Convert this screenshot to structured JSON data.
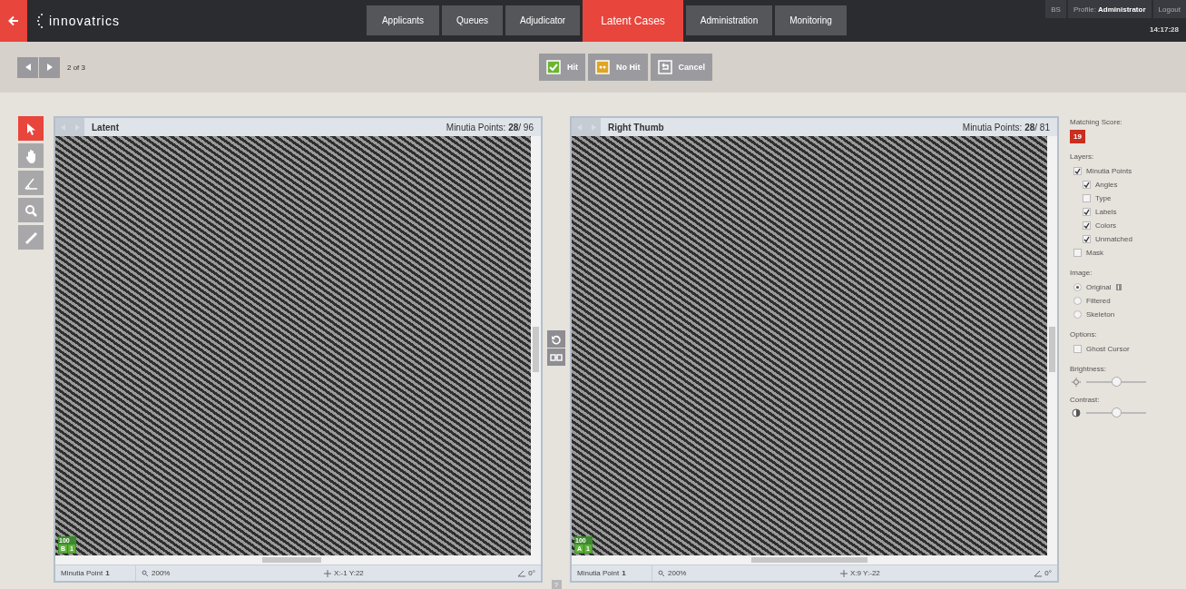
{
  "app": {
    "logo": "innovatrics"
  },
  "nav_tabs": [
    {
      "label": "Applicants",
      "selected": false
    },
    {
      "label": "Queues",
      "selected": false
    },
    {
      "label": "Adjudicator",
      "selected": false
    },
    {
      "label": "Latent Cases",
      "selected": true
    },
    {
      "label": "Administration",
      "selected": false
    },
    {
      "label": "Monitoring",
      "selected": false
    }
  ],
  "user": {
    "initials": "BS",
    "profile": "Profile: **Administrator**",
    "logout": "Logout",
    "time": "14:17:28"
  },
  "pager": {
    "text": "2 of 3"
  },
  "actions": [
    {
      "kind": "hit",
      "label": "Hit"
    },
    {
      "kind": "nohit",
      "label": "No Hit"
    },
    {
      "kind": "cancel",
      "label": "Cancel"
    }
  ],
  "tools": [
    {
      "kind": "pointer",
      "selected": true
    },
    {
      "kind": "hand",
      "selected": false
    },
    {
      "kind": "angle",
      "selected": false
    },
    {
      "kind": "zoom",
      "selected": false
    },
    {
      "kind": "ruler",
      "selected": false
    }
  ],
  "panels": [
    {
      "title": "Latent",
      "points": "Minutia Points: **28**/ 96",
      "badge_score": "100",
      "badge_letter": "B",
      "badge_count": "1",
      "footer_point": "Minutia Point **1**",
      "zoom": "200%",
      "coords": "X:-1 Y:22",
      "angle": "0°"
    },
    {
      "title": "Right Thumb",
      "points": "Minutia Points: **28**/ 81",
      "badge_score": "100",
      "badge_letter": "A",
      "badge_count": "1",
      "footer_point": "Minutia Point **1**",
      "zoom": "200%",
      "coords": "X:9 Y:-22",
      "angle": "0°"
    }
  ],
  "help": "?",
  "sidebar": {
    "score_label": "Matching Score:",
    "score": "19",
    "layers_label": "Layers:",
    "layers": [
      {
        "label": "Minutia Points",
        "checked": true,
        "children": [
          {
            "label": "Angles",
            "checked": true
          },
          {
            "label": "Type",
            "checked": false
          },
          {
            "label": "Labels",
            "checked": true
          },
          {
            "label": "Colors",
            "checked": true
          },
          {
            "label": "Unmatched",
            "checked": true
          }
        ]
      },
      {
        "label": "Mask",
        "checked": false
      }
    ],
    "image_label": "Image:",
    "image_options": [
      {
        "label": "Original",
        "selected": true,
        "info": "i"
      },
      {
        "label": "Filtered",
        "selected": false
      },
      {
        "label": "Skeleton",
        "selected": false
      }
    ],
    "options_label": "Options:",
    "options": [
      {
        "label": "Ghost Cursor",
        "checked": false
      }
    ],
    "brightness_label": "Brightness:",
    "brightness": {
      "level": 0.5
    },
    "contrast_label": "Contrast:",
    "contrast": {
      "level": 0.5
    }
  }
}
